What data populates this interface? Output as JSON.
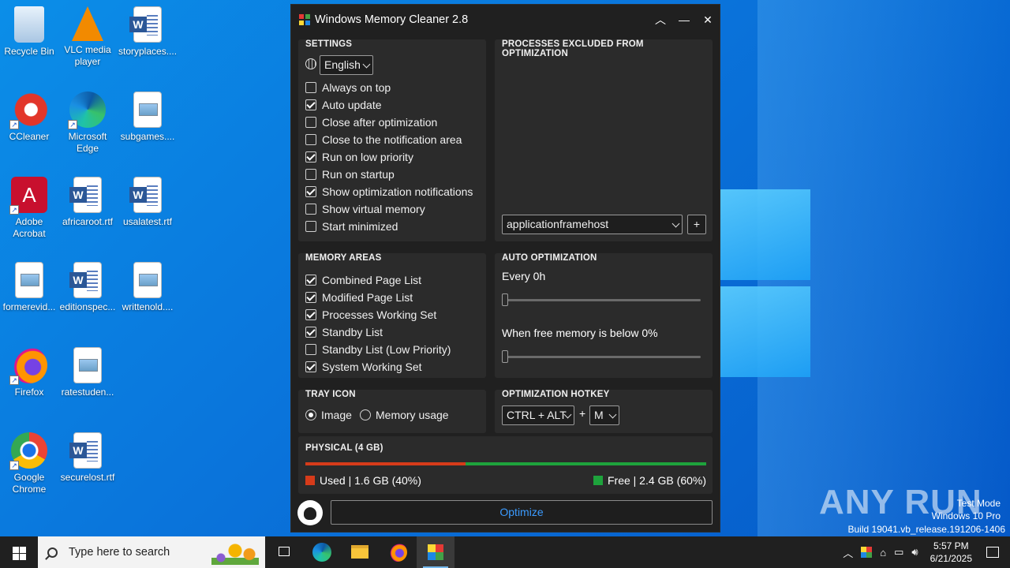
{
  "desktop": {
    "icons": [
      {
        "label": "Recycle Bin",
        "icon": "recycle-bin-icon"
      },
      {
        "label": "VLC media player",
        "icon": "vlc-icon"
      },
      {
        "label": "storyplaces....",
        "icon": "word-doc-icon"
      },
      {
        "label": "CCleaner",
        "icon": "ccleaner-icon"
      },
      {
        "label": "Microsoft Edge",
        "icon": "edge-icon"
      },
      {
        "label": "subgames....",
        "icon": "image-doc-icon"
      },
      {
        "label": "Adobe Acrobat",
        "icon": "acrobat-icon"
      },
      {
        "label": "africaroot.rtf",
        "icon": "word-doc-icon"
      },
      {
        "label": "usalatest.rtf",
        "icon": "word-doc-icon"
      },
      {
        "label": "formerevid...",
        "icon": "image-doc-icon"
      },
      {
        "label": "editionspec...",
        "icon": "word-doc-icon"
      },
      {
        "label": "writtenold....",
        "icon": "image-doc-icon"
      },
      {
        "label": "Firefox",
        "icon": "firefox-icon"
      },
      {
        "label": "ratestuden...",
        "icon": "image-doc-icon"
      },
      {
        "label": "Google Chrome",
        "icon": "chrome-icon"
      },
      {
        "label": "securelost.rtf",
        "icon": "word-doc-icon"
      }
    ]
  },
  "app": {
    "title": "Windows Memory Cleaner 2.8",
    "settings": {
      "heading": "SETTINGS",
      "language": "English",
      "options": [
        {
          "label": "Always on top",
          "checked": false
        },
        {
          "label": "Auto update",
          "checked": true
        },
        {
          "label": "Close after optimization",
          "checked": false
        },
        {
          "label": "Close to the notification area",
          "checked": false
        },
        {
          "label": "Run on low priority",
          "checked": true
        },
        {
          "label": "Run on startup",
          "checked": false
        },
        {
          "label": "Show optimization notifications",
          "checked": true
        },
        {
          "label": "Show virtual memory",
          "checked": false
        },
        {
          "label": "Start minimized",
          "checked": false
        }
      ]
    },
    "excluded": {
      "heading": "PROCESSES EXCLUDED FROM OPTIMIZATION",
      "process_select": "applicationframehost",
      "add_label": "+"
    },
    "memory_areas": {
      "heading": "MEMORY AREAS",
      "options": [
        {
          "label": "Combined Page List",
          "checked": true
        },
        {
          "label": "Modified Page List",
          "checked": true
        },
        {
          "label": "Processes Working Set",
          "checked": true
        },
        {
          "label": "Standby List",
          "checked": true
        },
        {
          "label": "Standby List (Low Priority)",
          "checked": false
        },
        {
          "label": "System Working Set",
          "checked": true
        }
      ]
    },
    "auto_optimization": {
      "heading": "AUTO OPTIMIZATION",
      "every_label": "Every 0h",
      "every_value": 0,
      "free_label": "When free memory is below 0%",
      "free_value": 0
    },
    "tray_icon": {
      "heading": "TRAY ICON",
      "image_label": "Image",
      "memory_label": "Memory usage",
      "selected": "Image"
    },
    "hotkey": {
      "heading": "OPTIMIZATION HOTKEY",
      "modifier": "CTRL + ALT",
      "plus": "+",
      "key": "M"
    },
    "physical": {
      "heading": "PHYSICAL (4 GB)",
      "used_label": "Used | 1.6 GB (40%)",
      "free_label": "Free | 2.4 GB (60%)",
      "used_fraction": 0.4,
      "used_color": "#d63b1a",
      "free_color": "#1ea33c"
    },
    "optimize_label": "Optimize"
  },
  "watermark": {
    "brand": "ANY RUN",
    "line1": "Test Mode",
    "line2": "Windows 10 Pro",
    "line3": "Build 19041.vb_release.191206-1406"
  },
  "taskbar": {
    "search_placeholder": "Type here to search",
    "time": "5:57 PM",
    "date": "6/21/2025"
  }
}
